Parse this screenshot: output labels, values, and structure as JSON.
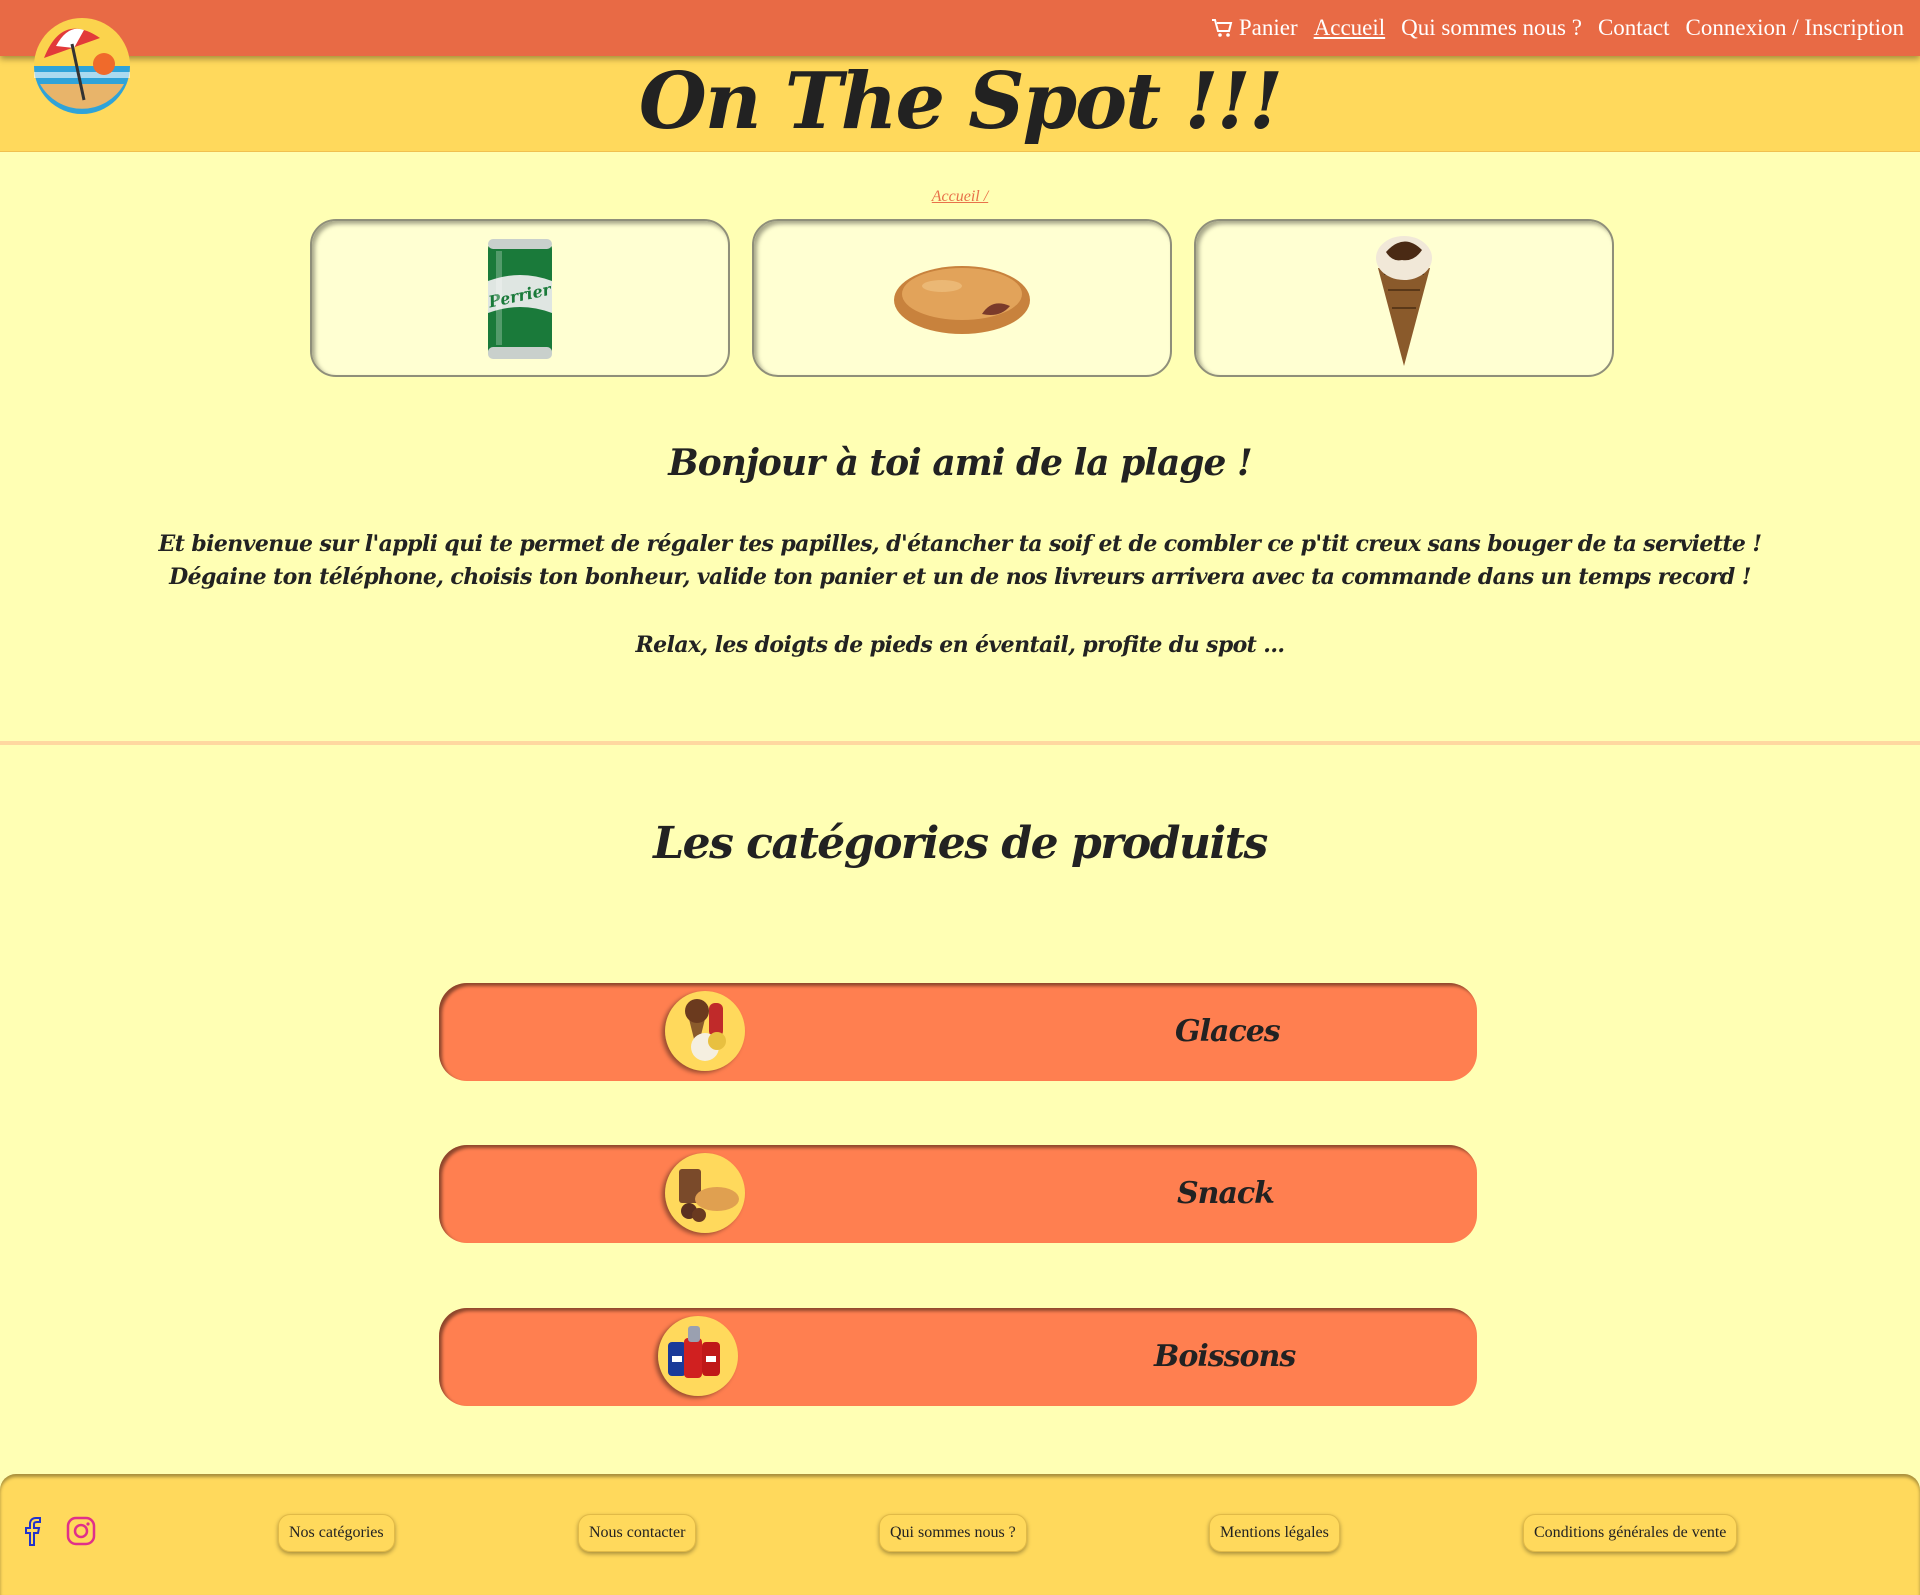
{
  "nav": {
    "cart_label": "Panier",
    "items": [
      "Accueil",
      "Qui sommes nous ?",
      "Contact",
      "Connexion / Inscription"
    ],
    "active": "Accueil"
  },
  "header": {
    "title": "On The Spot !!!"
  },
  "breadcrumb": "Accueil /",
  "products": [
    {
      "name": "perrier-can"
    },
    {
      "name": "donut"
    },
    {
      "name": "ice-cream-cone"
    }
  ],
  "intro": {
    "title": "Bonjour à toi ami de la plage !",
    "text": "Et bienvenue sur l'appli qui te permet de régaler tes papilles, d'étancher ta soif et de combler ce p'tit creux sans bouger de ta serviette ! Dégaine ton téléphone, choisis ton bonheur, valide ton panier et un de nos livreurs arrivera avec ta commande dans un temps record !",
    "relax": "Relax, les doigts de pieds en éventail, profite du spot ..."
  },
  "categories": {
    "title": "Les catégories de produits",
    "items": [
      {
        "label": "Glaces"
      },
      {
        "label": "Snack"
      },
      {
        "label": "Boissons"
      }
    ]
  },
  "footer": {
    "links": [
      "Nos catégories",
      "Nous contacter",
      "Qui sommes nous ?",
      "Mentions légales",
      "Conditions générales de vente"
    ],
    "social": [
      "facebook-icon",
      "instagram-icon"
    ]
  },
  "colors": {
    "nav_bg": "#e86a45",
    "header_bg": "#ffd95c",
    "page_bg": "#ffffb4",
    "category_bg": "#ff7f50",
    "breadcrumb": "#e8724a"
  }
}
